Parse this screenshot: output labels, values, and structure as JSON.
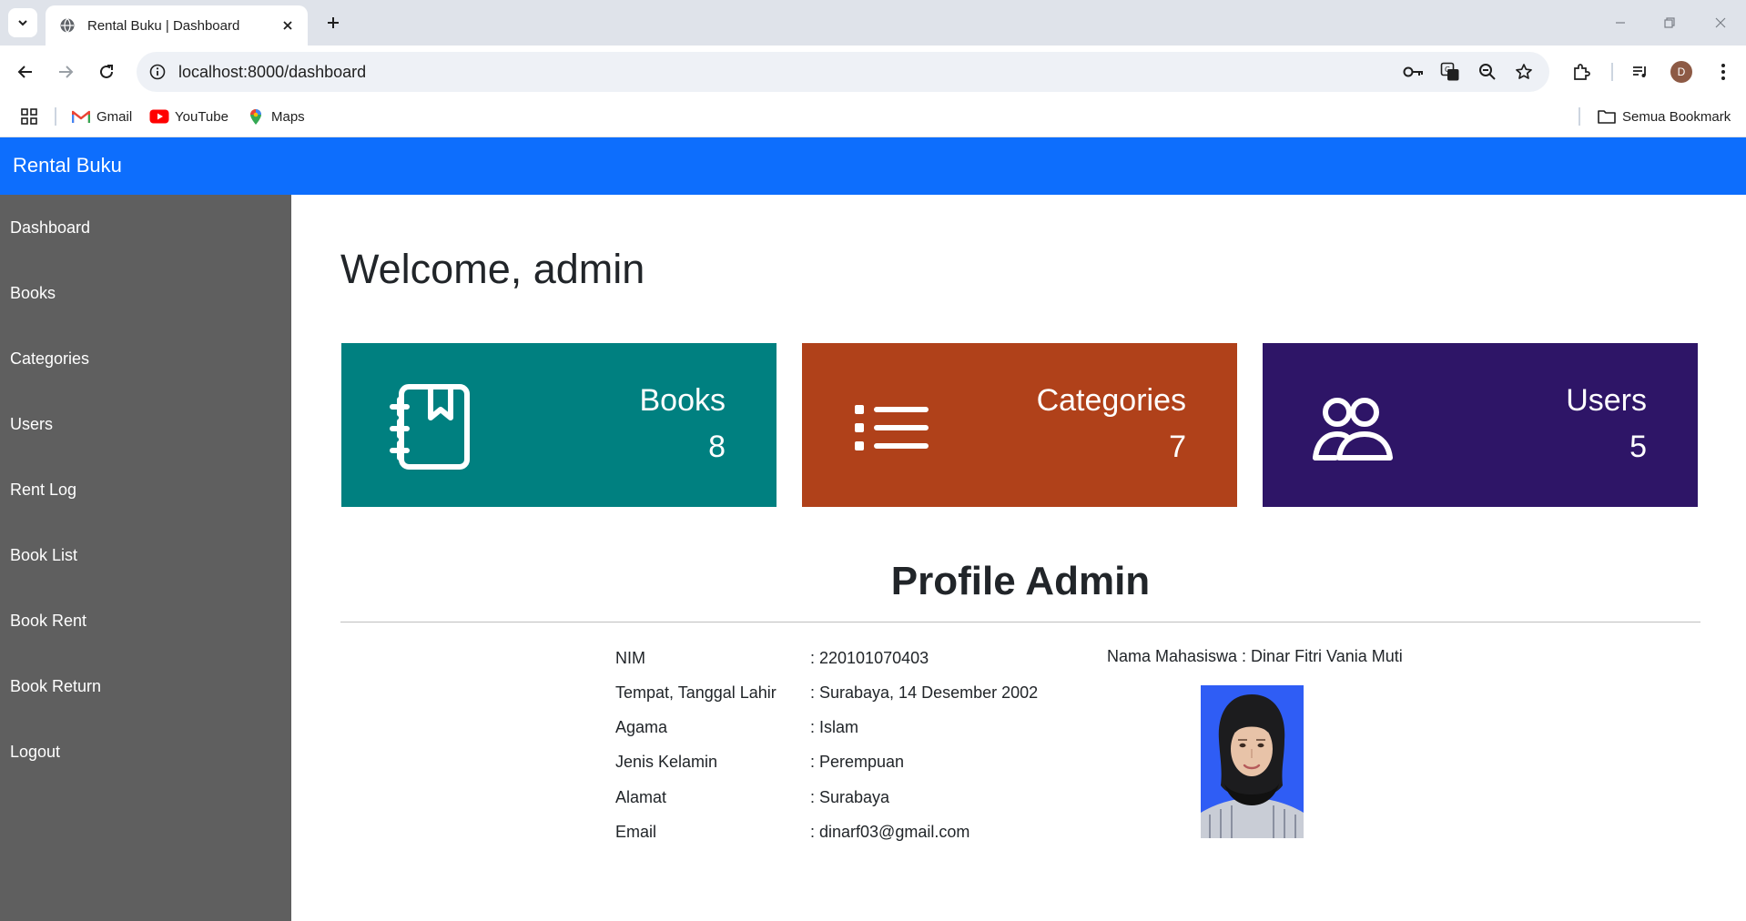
{
  "browser": {
    "tab_title": "Rental Buku | Dashboard",
    "url": "localhost:8000/dashboard",
    "profile_initial": "D",
    "bookmarks": [
      {
        "label": "Gmail",
        "icon": "gmail-icon"
      },
      {
        "label": "YouTube",
        "icon": "youtube-icon"
      },
      {
        "label": "Maps",
        "icon": "maps-icon"
      }
    ],
    "all_bookmarks_label": "Semua Bookmark"
  },
  "app": {
    "brand": "Rental Buku"
  },
  "sidebar": {
    "items": [
      {
        "label": "Dashboard"
      },
      {
        "label": "Books"
      },
      {
        "label": "Categories"
      },
      {
        "label": "Users"
      },
      {
        "label": "Rent Log"
      },
      {
        "label": "Book List"
      },
      {
        "label": "Book Rent"
      },
      {
        "label": "Book Return"
      },
      {
        "label": "Logout"
      }
    ]
  },
  "main": {
    "welcome": "Welcome, admin",
    "cards": [
      {
        "label": "Books",
        "value": "8",
        "color": "#008080",
        "icon": "book-icon"
      },
      {
        "label": "Categories",
        "value": "7",
        "color": "#b0411a",
        "icon": "list-icon"
      },
      {
        "label": "Users",
        "value": "5",
        "color": "#2e1567",
        "icon": "users-icon"
      }
    ],
    "profile": {
      "title": "Profile Admin",
      "rows": [
        {
          "label": "NIM",
          "value": ": 220101070403"
        },
        {
          "label": "Tempat, Tanggal Lahir",
          "value": ": Surabaya, 14 Desember 2002"
        },
        {
          "label": "Agama",
          "value": ": Islam"
        },
        {
          "label": "Jenis Kelamin",
          "value": ": Perempuan"
        },
        {
          "label": "Alamat",
          "value": ": Surabaya"
        },
        {
          "label": "Email",
          "value": ": dinarf03@gmail.com"
        }
      ],
      "student_name": "Nama Mahasiswa : Dinar Fitri Vania Muti"
    }
  }
}
